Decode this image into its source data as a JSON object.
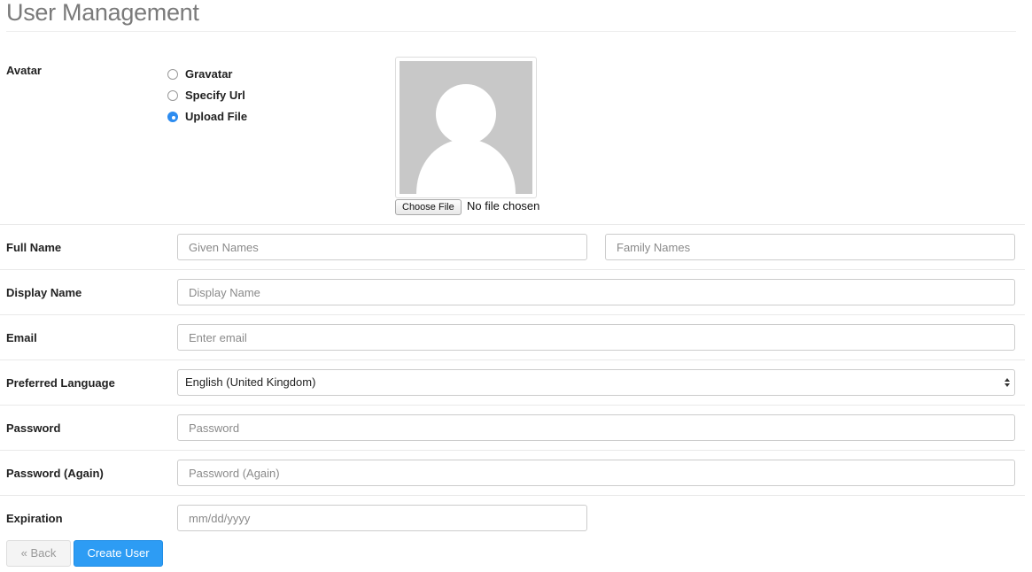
{
  "page": {
    "title": "User Management"
  },
  "avatar": {
    "label": "Avatar",
    "options": [
      {
        "label": "Gravatar",
        "checked": false
      },
      {
        "label": "Specify Url",
        "checked": false
      },
      {
        "label": "Upload File",
        "checked": true
      }
    ],
    "choose_file_label": "Choose File",
    "file_status": "No file chosen"
  },
  "form": {
    "full_name": {
      "label": "Full Name",
      "given_placeholder": "Given Names",
      "family_placeholder": "Family Names"
    },
    "display_name": {
      "label": "Display Name",
      "placeholder": "Display Name"
    },
    "email": {
      "label": "Email",
      "placeholder": "Enter email"
    },
    "language": {
      "label": "Preferred Language",
      "value": "English (United Kingdom)"
    },
    "password": {
      "label": "Password",
      "placeholder": "Password"
    },
    "password_again": {
      "label": "Password (Again)",
      "placeholder": "Password (Again)"
    },
    "expiration": {
      "label": "Expiration",
      "placeholder": "mm/dd/yyyy"
    }
  },
  "actions": {
    "back_label": "« Back",
    "create_label": "Create User"
  },
  "colors": {
    "accent": "#2d9cf4",
    "avatar_bg": "#c8c8c8"
  }
}
